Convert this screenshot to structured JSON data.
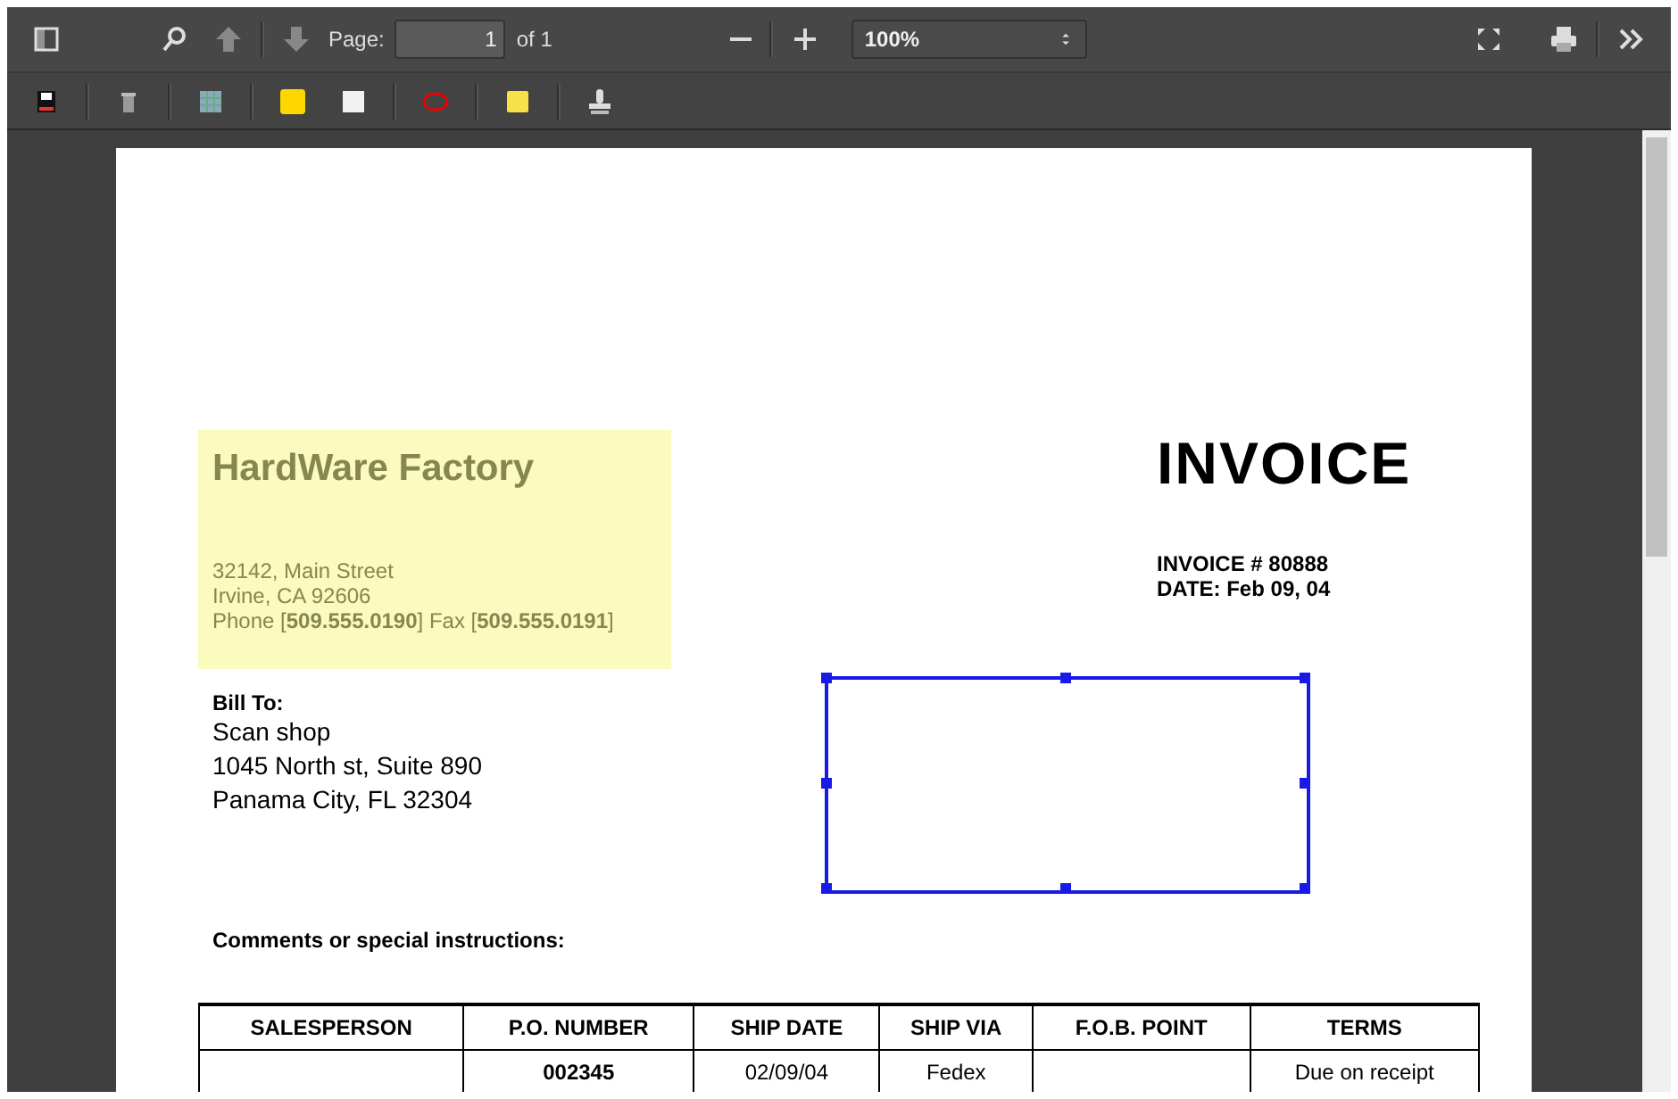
{
  "toolbar": {
    "page_label": "Page:",
    "page_value": "1",
    "page_total": "of 1",
    "zoom": "100%"
  },
  "document": {
    "company": {
      "name": "HardWare Factory",
      "lines": [
        "32142, Main Street",
        "Irvine, CA 92606",
        "Phone [**509.555.0190**]  Fax [**509.555.0191**]"
      ]
    },
    "title": "INVOICE",
    "invoice_number": "INVOICE # 80888",
    "date": "DATE: Feb 09, 04",
    "bill_to": {
      "label": "Bill To:",
      "lines": [
        "Scan shop",
        "1045 North st, Suite 890",
        "Panama City, FL 32304"
      ]
    },
    "comments_label": "Comments or special instructions:",
    "table": {
      "columns": [
        "SALESPERSON",
        "P.O. NUMBER",
        "SHIP DATE",
        "SHIP VIA",
        "F.O.B. POINT",
        "TERMS"
      ],
      "rows": [
        [
          {},
          {
            "text": "002345",
            "bold": true
          },
          {
            "text": "02/09/04",
            "bold": false
          },
          {
            "text": "Fedex",
            "bold": false
          },
          {},
          {
            "text": "Due on receipt",
            "bold": false
          }
        ]
      ]
    }
  }
}
